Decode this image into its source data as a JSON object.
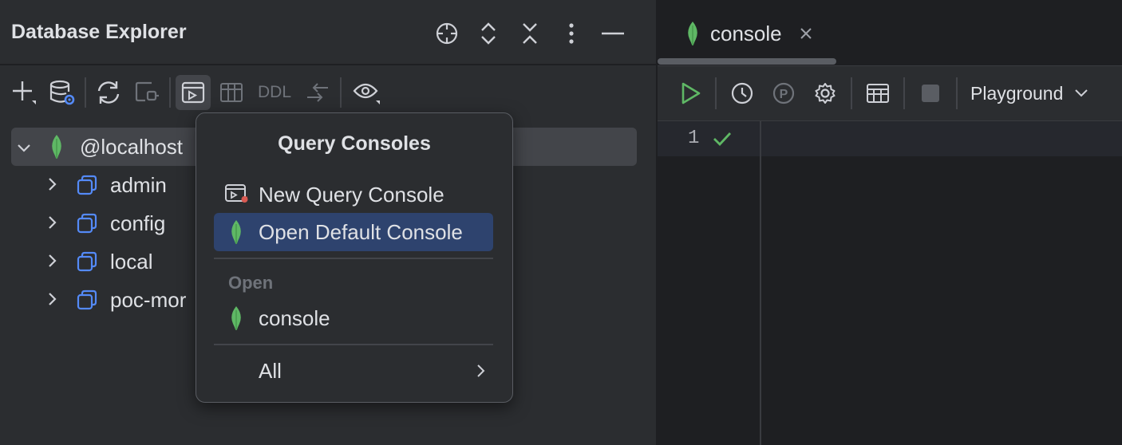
{
  "explorer": {
    "title": "Database Explorer",
    "header_icons": [
      "locate-icon",
      "expand-all-icon",
      "collapse-all-icon",
      "more-icon",
      "minimize-icon"
    ],
    "toolbar": {
      "buttons": [
        "add-icon",
        "data-source-properties-icon",
        "refresh-icon",
        "disconnect-icon",
        "query-console-icon",
        "table-editor-icon",
        "arrows-icon",
        "view-options-icon"
      ],
      "ddl_label": "DDL"
    },
    "tree": {
      "root": "@localhost",
      "databases": [
        "admin",
        "config",
        "local",
        "poc-mor"
      ]
    }
  },
  "popup": {
    "title": "Query Consoles",
    "new_console": "New Query Console",
    "open_default": "Open Default Console",
    "open_section": "Open",
    "console_item": "console",
    "all_item": "All"
  },
  "editor": {
    "tab_label": "console",
    "mode_select": "Playground",
    "line_number": "1",
    "toolbar_buttons": [
      "run-icon",
      "history-icon",
      "parameters-icon",
      "settings-icon",
      "table-view-icon",
      "stop-icon"
    ]
  },
  "colors": {
    "mongo_green": "#5fb865",
    "highlight": "#2e436e",
    "accent_blue": "#548af7",
    "run_green": "#5fb865"
  }
}
